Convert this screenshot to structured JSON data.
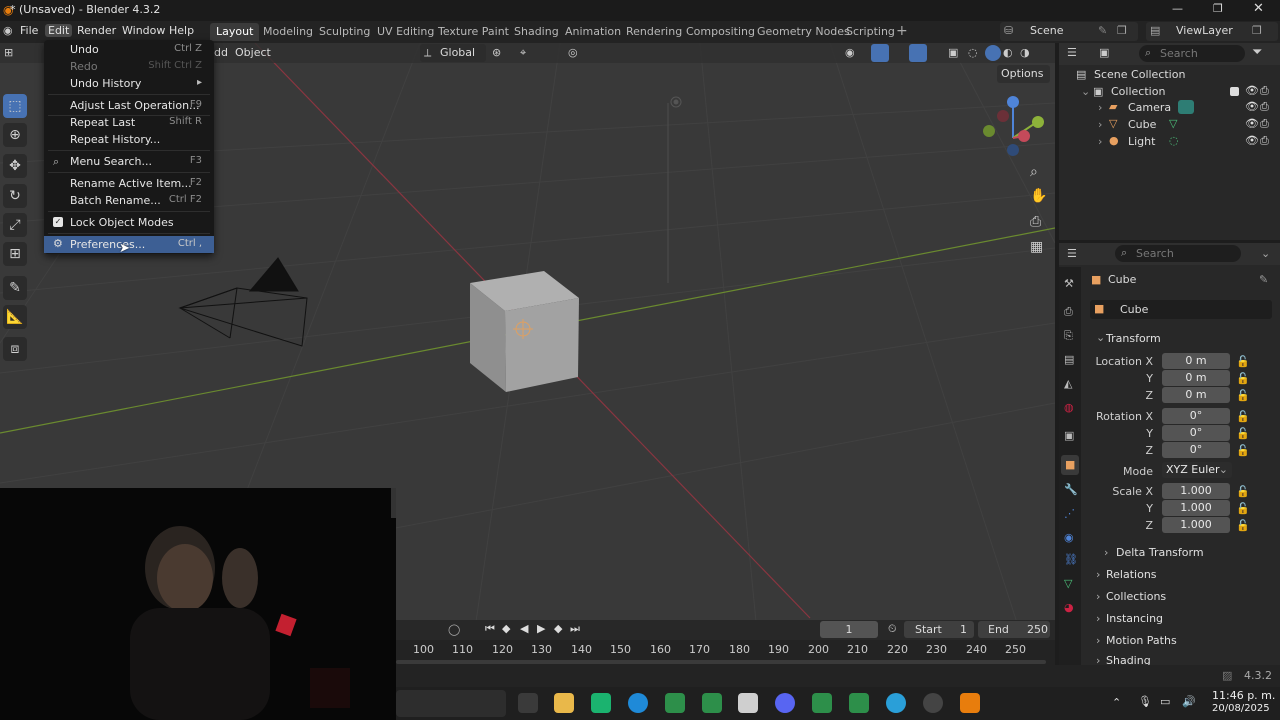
{
  "window": {
    "title": "* (Unsaved) - Blender 4.3.2"
  },
  "menus": [
    "File",
    "Edit",
    "Render",
    "Window",
    "Help"
  ],
  "workspaces": [
    "Layout",
    "Modeling",
    "Sculpting",
    "UV Editing",
    "Texture Paint",
    "Shading",
    "Animation",
    "Rendering",
    "Compositing",
    "Geometry Nodes",
    "Scripting"
  ],
  "active_workspace": "Layout",
  "scene": {
    "name": "Scene",
    "view_layer": "ViewLayer"
  },
  "viewport_header": {
    "object_menu": "Object",
    "add_partial": "dd",
    "orientation": "Global",
    "options": "Options"
  },
  "edit_menu": {
    "items": [
      {
        "label": "Undo",
        "shortcut": "Ctrl Z",
        "disabled": false
      },
      {
        "label": "Redo",
        "shortcut": "Shift Ctrl Z",
        "disabled": true
      },
      {
        "label": "Undo History",
        "shortcut": "",
        "disabled": false,
        "submenu": true
      },
      {
        "label": "Adjust Last Operation...",
        "shortcut": "F9",
        "disabled": false
      },
      {
        "label": "Repeat Last",
        "shortcut": "Shift R",
        "disabled": false
      },
      {
        "label": "Repeat History...",
        "shortcut": "",
        "disabled": false
      },
      {
        "label": "Menu Search...",
        "shortcut": "F3",
        "disabled": false
      },
      {
        "label": "Rename Active Item...",
        "shortcut": "F2",
        "disabled": false
      },
      {
        "label": "Batch Rename...",
        "shortcut": "Ctrl F2",
        "disabled": false
      },
      {
        "label": "Lock Object Modes",
        "shortcut": "",
        "disabled": false,
        "checked": true
      },
      {
        "label": "Preferences...",
        "shortcut": "Ctrl ,",
        "disabled": false,
        "highlighted": true
      }
    ]
  },
  "outliner": {
    "search_placeholder": "Search",
    "root": "Scene Collection",
    "collection": "Collection",
    "objects": [
      "Camera",
      "Cube",
      "Light"
    ]
  },
  "properties": {
    "search_placeholder": "Search",
    "object_name": "Cube",
    "data_name": "Cube",
    "transform_label": "Transform",
    "location": {
      "label": "Location X",
      "x": "0 m",
      "y": "0 m",
      "z": "0 m"
    },
    "rotation": {
      "label": "Rotation X",
      "x": "0°",
      "y": "0°",
      "z": "0°"
    },
    "mode": {
      "label": "Mode",
      "value": "XYZ Euler"
    },
    "scale": {
      "label": "Scale X",
      "x": "1.000",
      "y": "1.000",
      "z": "1.000"
    },
    "axis_y": "Y",
    "axis_z": "Z",
    "panels": [
      "Delta Transform",
      "Relations",
      "Collections",
      "Instancing",
      "Motion Paths",
      "Shading"
    ]
  },
  "timeline": {
    "current_frame": "1",
    "start_label": "Start",
    "start": "1",
    "end_label": "End",
    "end": "250",
    "ticks": [
      "100",
      "110",
      "120",
      "130",
      "140",
      "150",
      "160",
      "170",
      "180",
      "190",
      "200",
      "210",
      "220",
      "230",
      "240",
      "250"
    ]
  },
  "status": {
    "version": "4.3.2"
  },
  "taskbar": {
    "time": "11:46 p. m.",
    "date": "20/08/2025"
  },
  "colors": {
    "accent": "#4772b3",
    "x_axis": "#c44a5a",
    "y_axis": "#8db23a",
    "z_axis": "#4f84d8"
  }
}
